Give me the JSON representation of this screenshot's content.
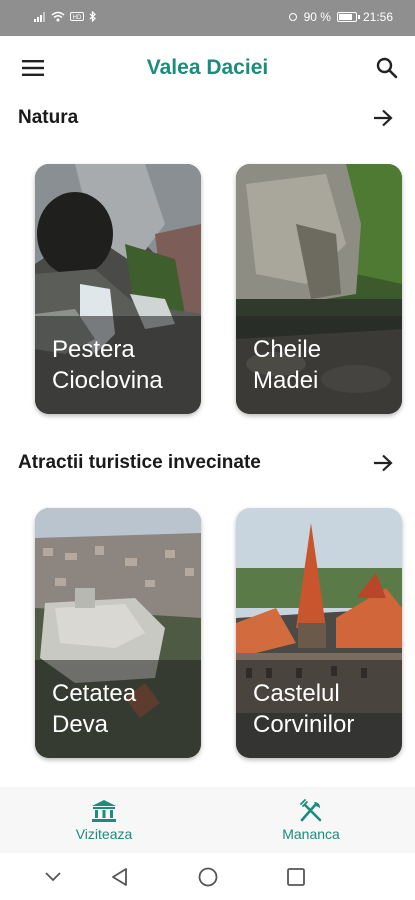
{
  "status_bar": {
    "battery_text": "90 %",
    "time": "21:56",
    "battery_level": 0.9
  },
  "app_bar": {
    "title": "Valea Daciei",
    "menu_icon": "hamburger-menu-icon",
    "search_icon": "search-icon"
  },
  "sections": [
    {
      "title": "Natura",
      "cards": [
        {
          "label_line1": "Pestera",
          "label_line2": "Cioclovina"
        },
        {
          "label_line1": "Cheile",
          "label_line2": "Madei"
        }
      ]
    },
    {
      "title": "Atractii turistice invecinate",
      "cards": [
        {
          "label_line1": "Cetatea",
          "label_line2": "Deva"
        },
        {
          "label_line1": "Castelul",
          "label_line2": "Corvinilor"
        }
      ]
    }
  ],
  "bottom_nav": {
    "items": [
      {
        "label": "Viziteaza",
        "icon": "museum-icon"
      },
      {
        "label": "Mananca",
        "icon": "restaurant-icon"
      }
    ],
    "accent_color": "#1c8c7c"
  },
  "system_nav": {
    "icons": [
      "chevron-down-icon",
      "back-icon",
      "home-icon",
      "recents-icon"
    ]
  }
}
